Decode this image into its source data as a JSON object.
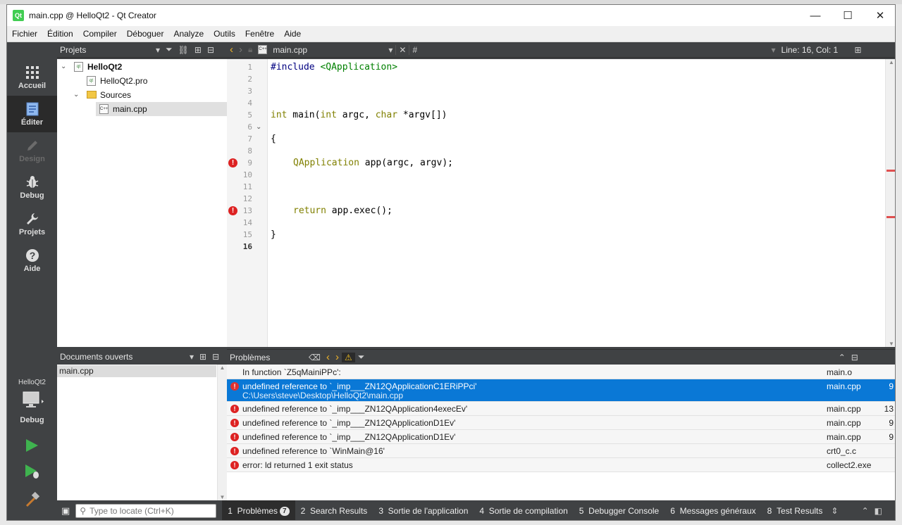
{
  "window": {
    "title": "main.cpp @ HelloQt2 - Qt Creator",
    "logo_text": "Qt"
  },
  "window_controls": [
    "—",
    "☐",
    "✕"
  ],
  "menu": [
    "Fichier",
    "Édition",
    "Compiler",
    "Déboguer",
    "Analyze",
    "Outils",
    "Fenêtre",
    "Aide"
  ],
  "modes": [
    {
      "label": "Accueil",
      "icon": "grid-icon"
    },
    {
      "label": "Éditer",
      "icon": "edit-document-icon"
    },
    {
      "label": "Design",
      "icon": "pencil-icon"
    },
    {
      "label": "Debug",
      "icon": "bug-icon"
    },
    {
      "label": "Projets",
      "icon": "wrench-icon"
    },
    {
      "label": "Aide",
      "icon": "help-icon"
    }
  ],
  "kit": {
    "project": "HelloQt2",
    "build": "Debug"
  },
  "projects_panel": {
    "title": "Projets"
  },
  "tree": {
    "project": "HelloQt2",
    "pro_file": "HelloQt2.pro",
    "sources": "Sources",
    "main_file": "main.cpp"
  },
  "editor_toolbar": {
    "filename": "main.cpp",
    "symbol": "#",
    "position": "Line: 16, Col: 1"
  },
  "editor": {
    "line_numbers": [
      "1",
      "2",
      "3",
      "4",
      "5",
      "6",
      "7",
      "8",
      "9",
      "10",
      "11",
      "12",
      "13",
      "14",
      "15",
      "16"
    ],
    "current_line": "16",
    "error_lines": [
      "9",
      "13"
    ],
    "code": {
      "l1_directive": "#include",
      "l1_header": " <QApplication>",
      "l5_int": "int",
      "l5_mid": " main(",
      "l5_int2": "int",
      "l5_argc": " argc, ",
      "l5_char": "char",
      "l5_end": " *argv[])",
      "l7": "{",
      "l9_type": "QApplication",
      "l9_rest": " app(argc, argv);",
      "l13_kw": "return",
      "l13_rest": " app.exec();",
      "l15": "}"
    }
  },
  "open_docs": {
    "title": "Documents ouverts",
    "items": [
      "main.cpp"
    ]
  },
  "issues_panel": {
    "title": "Problèmes"
  },
  "issues": [
    {
      "text": "In function `Z5qMainiPPc':",
      "file": "main.o",
      "line": "",
      "error": false
    },
    {
      "text": "undefined reference to `_imp___ZN12QApplicationC1ERiPPci'",
      "sub": "C:\\Users\\steve\\Desktop\\HelloQt2\\main.cpp",
      "file": "main.cpp",
      "line": "9",
      "error": true,
      "selected": true
    },
    {
      "text": "undefined reference to `_imp___ZN12QApplication4execEv'",
      "file": "main.cpp",
      "line": "13",
      "error": true
    },
    {
      "text": "undefined reference to `_imp___ZN12QApplicationD1Ev'",
      "file": "main.cpp",
      "line": "9",
      "error": true
    },
    {
      "text": "undefined reference to `_imp___ZN12QApplicationD1Ev'",
      "file": "main.cpp",
      "line": "9",
      "error": true
    },
    {
      "text": "undefined reference to `WinMain@16'",
      "file": "crt0_c.c",
      "line": "",
      "error": true
    },
    {
      "text": "error: ld returned 1 exit status",
      "file": "collect2.exe",
      "line": "",
      "error": true
    }
  ],
  "status": {
    "locator_placeholder": "Type to locate (Ctrl+K)",
    "tabs": [
      {
        "num": "1",
        "label": "Problèmes",
        "badge": "7"
      },
      {
        "num": "2",
        "label": "Search Results"
      },
      {
        "num": "3",
        "label": "Sortie de l'application"
      },
      {
        "num": "4",
        "label": "Sortie de compilation"
      },
      {
        "num": "5",
        "label": "Debugger Console"
      },
      {
        "num": "6",
        "label": "Messages généraux"
      },
      {
        "num": "8",
        "label": "Test Results"
      }
    ]
  },
  "colors": {
    "accent": "#0a78d6",
    "error": "#dd2222",
    "run": "#3fb34f"
  }
}
